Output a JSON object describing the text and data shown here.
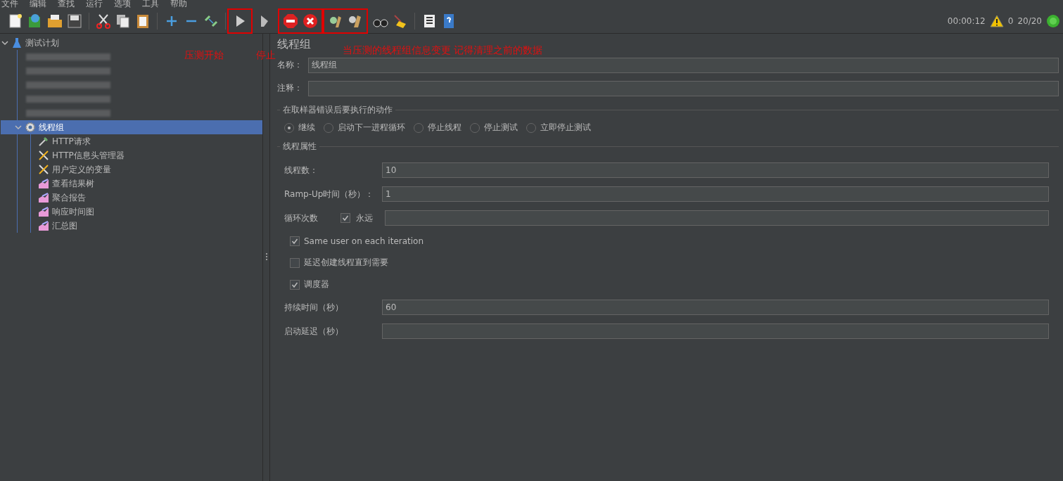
{
  "menu": [
    "文件",
    "编辑",
    "查找",
    "运行",
    "选项",
    "工具",
    "帮助"
  ],
  "toolbar": {
    "items": [
      {
        "kind": "group",
        "highlighted": false,
        "icons": [
          {
            "kind": "new"
          },
          {
            "kind": "templates"
          },
          {
            "kind": "open"
          },
          {
            "kind": "save"
          }
        ]
      },
      {
        "kind": "separator"
      },
      {
        "kind": "group",
        "highlighted": false,
        "icons": [
          {
            "kind": "cut"
          },
          {
            "kind": "copy"
          },
          {
            "kind": "paste"
          }
        ]
      },
      {
        "kind": "separator"
      },
      {
        "kind": "group",
        "highlighted": false,
        "icons": [
          {
            "kind": "expand"
          },
          {
            "kind": "collapse"
          },
          {
            "kind": "toggle"
          }
        ]
      },
      {
        "kind": "separator"
      },
      {
        "kind": "group",
        "highlighted": true,
        "icons": [
          {
            "kind": "start"
          }
        ]
      },
      {
        "kind": "group",
        "highlighted": false,
        "icons": [
          {
            "kind": "start-no-pause"
          }
        ]
      },
      {
        "kind": "group",
        "highlighted": true,
        "icons": [
          {
            "kind": "stop"
          },
          {
            "kind": "shutdown"
          }
        ]
      },
      {
        "kind": "group",
        "highlighted": true,
        "icons": [
          {
            "kind": "clear"
          },
          {
            "kind": "clear-all"
          }
        ]
      },
      {
        "kind": "group",
        "highlighted": false,
        "icons": [
          {
            "kind": "search"
          },
          {
            "kind": "reset"
          }
        ]
      },
      {
        "kind": "separator"
      },
      {
        "kind": "group",
        "highlighted": false,
        "icons": [
          {
            "kind": "functions"
          },
          {
            "kind": "help"
          }
        ]
      }
    ],
    "elapsed": "00:00:12",
    "warnings": "0",
    "threads": "20/20"
  },
  "annotations": [
    {
      "text": "压测开始"
    },
    {
      "text": "停止"
    },
    {
      "text": "当压测的线程组信息变更 记得清理之前的数据"
    }
  ],
  "tree": [
    {
      "label": "测试计划",
      "kind": "plan",
      "selected": false,
      "expanded": true,
      "children": [
        {
          "kind": "redacted"
        },
        {
          "kind": "redacted"
        },
        {
          "kind": "redacted"
        },
        {
          "kind": "redacted"
        },
        {
          "kind": "redacted"
        },
        {
          "label": "线程组",
          "kind": "thread-group",
          "selected": true,
          "expanded": true,
          "children": [
            {
              "label": "HTTP请求",
              "kind": "sampler",
              "selected": false
            },
            {
              "label": "HTTP信息头管理器",
              "kind": "config",
              "selected": false
            },
            {
              "label": "用户定义的变量",
              "kind": "config",
              "selected": false
            },
            {
              "label": "查看结果树",
              "kind": "listener",
              "selected": false
            },
            {
              "label": "聚合报告",
              "kind": "listener",
              "selected": false
            },
            {
              "label": "响应时间图",
              "kind": "listener",
              "selected": false
            },
            {
              "label": "汇总图",
              "kind": "listener",
              "selected": false
            }
          ]
        }
      ]
    }
  ],
  "panel": {
    "title": "线程组",
    "name": {
      "label": "名称：",
      "value": "线程组"
    },
    "comment": {
      "label": "注释："
    },
    "error_action": {
      "title": "在取样器错误后要执行的动作",
      "options": [
        {
          "label": "继续",
          "selected": true
        },
        {
          "label": "启动下一进程循环",
          "selected": false
        },
        {
          "label": "停止线程",
          "selected": false
        },
        {
          "label": "停止测试",
          "selected": false
        },
        {
          "label": "立即停止测试",
          "selected": false
        }
      ]
    },
    "properties": {
      "title": "线程属性",
      "rows": [
        {
          "kind": "field",
          "label": "线程数：",
          "value": "10"
        },
        {
          "kind": "field",
          "label": "Ramp-Up时间（秒）：",
          "value": "1"
        },
        {
          "kind": "loop",
          "label": "循环次数",
          "check_label": "永远",
          "checked": true
        },
        {
          "kind": "check",
          "label": "Same user on each iteration",
          "checked": true
        },
        {
          "kind": "check",
          "label": "延迟创建线程直到需要",
          "checked": false
        },
        {
          "kind": "check",
          "label": "调度器",
          "checked": true
        },
        {
          "kind": "field",
          "label": "持续时间（秒）",
          "value": "60"
        },
        {
          "kind": "field",
          "label": "启动延迟（秒）"
        }
      ]
    }
  }
}
